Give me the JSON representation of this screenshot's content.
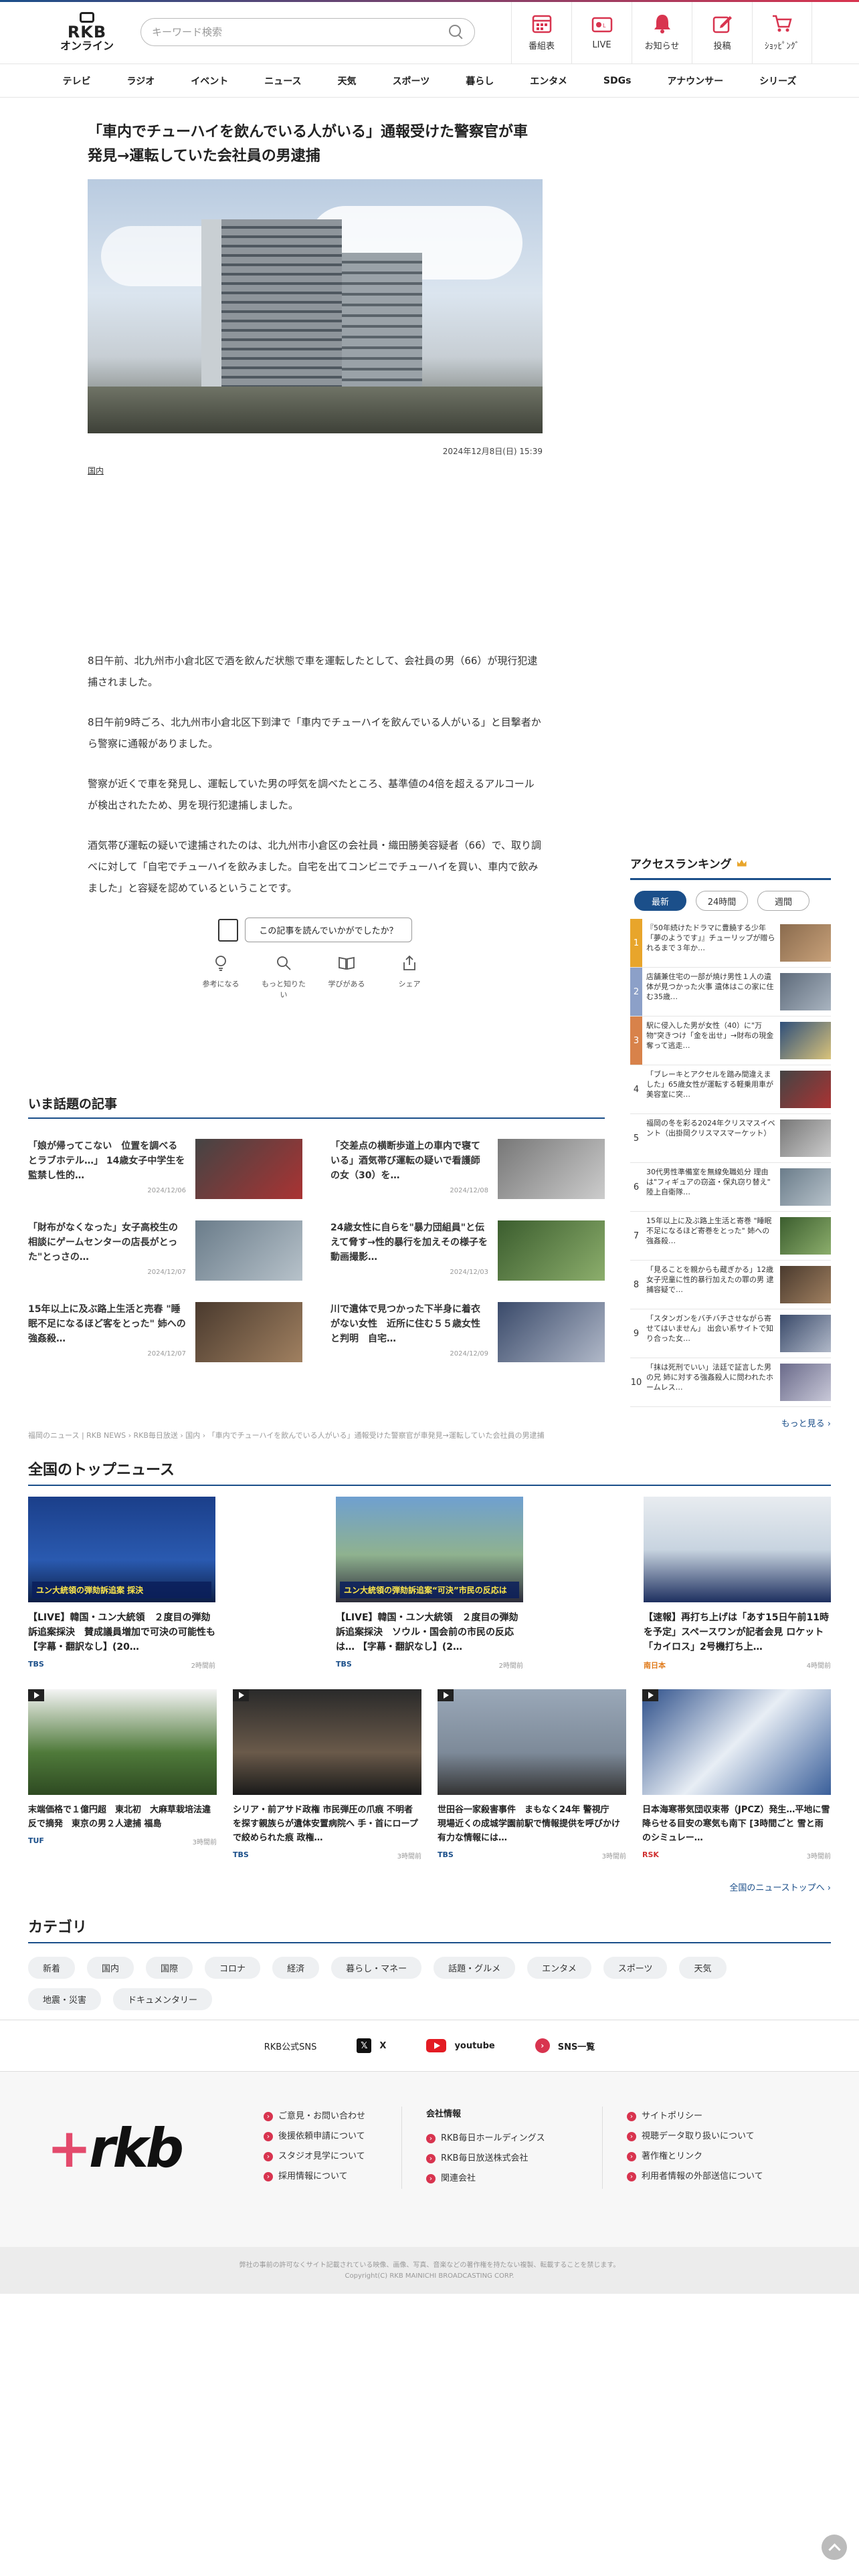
{
  "header": {
    "logo_line1": "RKB",
    "logo_line2": "オンライン",
    "search_placeholder": "キーワード検索",
    "nav": [
      {
        "label": "番組表",
        "color": "#d8344f"
      },
      {
        "label": "LIVE",
        "color": "#d8344f"
      },
      {
        "label": "お知らせ",
        "color": "#d8344f"
      },
      {
        "label": "投稿",
        "color": "#d8344f"
      },
      {
        "label": "ｼｮｯﾋﾟﾝｸﾞ",
        "color": "#d8344f"
      }
    ]
  },
  "global_nav": [
    "テレビ",
    "ラジオ",
    "イベント",
    "ニュース",
    "天気",
    "スポーツ",
    "暮らし",
    "エンタメ",
    "SDGs",
    "アナウンサー",
    "シリーズ"
  ],
  "article": {
    "title": "「車内でチューハイを飲んでいる人がいる」通報受けた警察官が車発見→運転していた会社員の男逮捕",
    "date": "2024年12月8日(日) 15:39",
    "category": "国内",
    "paragraphs": [
      "8日午前、北九州市小倉北区で酒を飲んだ状態で車を運転したとして、会社員の男（66）が現行犯逮捕されました。",
      "8日午前9時ごろ、北九州市小倉北区下到津で「車内でチューハイを飲んでいる人がいる」と目撃者から警察に通報がありました。",
      "警察が近くで車を発見し、運転していた男の呼気を調べたところ、基準値の4倍を超えるアルコールが検出されたため、男を現行犯逮捕しました。",
      "酒気帯び運転の疑いで逮捕されたのは、北九州市小倉区の会社員・織田勝美容疑者（66）で、取り調べに対して「自宅でチューハイを飲みました。自宅を出てコンビニでチューハイを買い、車内で飲みました」と容疑を認めているということです。"
    ],
    "feedback": {
      "question": "この記事を読んでいかがでしたか？",
      "buttons": [
        "参考になる",
        "もっと知りたい",
        "学びがある",
        "シェア"
      ]
    }
  },
  "ranking": {
    "title": "アクセスランキング",
    "tabs": [
      "最新",
      "24時間",
      "週間"
    ],
    "items": [
      {
        "num": "1",
        "color": "#e8a52b",
        "text": "『50年続けたドラマに豊饒する少年「夢のようです」』チューリップが贈られるまで３年か…"
      },
      {
        "num": "2",
        "color": "#8ca0c8",
        "text": "店舗兼住宅の一部が焼け男性１人の遺体が見つかった火事 遺体はこの家に住む35歳…"
      },
      {
        "num": "3",
        "color": "#d8824a",
        "text": "駅に侵入した男が女性（40）に\"万物\"突きつけ「金を出せ」→財布の現金奪って逃走…"
      },
      {
        "num": "4",
        "color": "#fff",
        "text": "「ブレーキとアクセルを踏み間違えました」65歳女性が運転する軽乗用車が美容室に突…"
      },
      {
        "num": "5",
        "color": "#fff",
        "text": "福岡の冬を彩る2024年クリスマスイベント（出掛岡クリスマスマーケット）"
      },
      {
        "num": "6",
        "color": "#fff",
        "text": "30代男性準備室を無線免職処分 理由は\"フィギュアの窃盗・保丸窃り替え\" 陸上自衛隊…"
      },
      {
        "num": "7",
        "color": "#fff",
        "text": "15年以上に及ぶ路上生活と寄巻 \"睡眠不足になるほど寄巻をとった\" 姉への強姦殺…"
      },
      {
        "num": "8",
        "color": "#fff",
        "text": "「見ることを親からも蔵ぎかる」12歳女子児童に性的暴行加えたの罪の男 逮捕容疑で…"
      },
      {
        "num": "9",
        "color": "#fff",
        "text": "「スタンガンをバチバチさせながら寄せてはいません」 出会い系サイトで知り合った女…"
      },
      {
        "num": "10",
        "color": "#fff",
        "text": "「抹は死刑でいい」法廷で証言した男の兄 姉に対する強姦殺人に問われたホームレス…"
      }
    ],
    "more": "もっと見る ›"
  },
  "trending": {
    "title": "いま話題の記事",
    "items": [
      {
        "text": "「娘が帰ってこない　位置を調べるとラブホテル…」 14歳女子中学生を監禁し性的…",
        "date": "2024/12/06"
      },
      {
        "text": "「交差点の横断歩道上の車内で寝ている」酒気帯び運転の疑いで看護師の女（30）を…",
        "date": "2024/12/08"
      },
      {
        "text": "「財布がなくなった」女子高校生の相談にゲームセンターの店長がとった\"とっさの…",
        "date": "2024/12/07"
      },
      {
        "text": "24歳女性に自らを\"暴力団組員\"と伝えて脅す→性的暴行を加えその様子を動画撮影…",
        "date": "2024/12/03"
      },
      {
        "text": "15年以上に及ぶ路上生活と売春 \"睡眠不足になるほど客をとった\" 姉への強姦殺…",
        "date": "2024/12/07"
      },
      {
        "text": "川で遺体で見つかった下半身に着衣がない女性　近所に住む５５歳女性と判明　自宅…",
        "date": "2024/12/09"
      }
    ]
  },
  "breadcrumb": "福岡のニュース | RKB NEWS › RKB毎日放送 › 国内 › 「車内でチューハイを飲んでいる人がいる」通報受けた警察官が車発見→運転していた会社員の男逮捕",
  "top_news": {
    "title": "全国のトップニュース",
    "big": [
      {
        "text": "【LIVE】韓国・ユン大統領　２度目の弾劾訴追案採決　賛成議員増加で可決の可能性も 【字幕・翻訳なし】(20…",
        "source": "TBS",
        "ago": "2時間前",
        "caption": "ユン大統領の弾劾訴追案 採決"
      },
      {
        "text": "【LIVE】韓国・ユン大統領　２度目の弾劾訴追案採決　ソウル・国会前の市民の反応は… 【字幕・翻訳なし】(2…",
        "source": "TBS",
        "ago": "2時間前",
        "caption": "ユン大統領の弾劾訴追案“可決”市民の反応は"
      },
      {
        "text": "【速報】再打ち上げは「あす15日午前11時を予定」スペースワンが記者会見 ロケット「カイロス」2号機打ち上…",
        "source": "南日本",
        "ago": "4時間前",
        "caption": ""
      }
    ],
    "small": [
      {
        "text": "末端価格で１億円超　東北初　大麻草栽培法違反で摘発　東京の男２人逮捕 福島",
        "source": "TUF",
        "ago": "3時間前"
      },
      {
        "text": "シリア・前アサド政権 市民弾圧の爪痕 不明者を探す親族らが遺体安置病院へ 手・首にロープで絞められた痕 政権…",
        "source": "TBS",
        "ago": "3時間前"
      },
      {
        "text": "世田谷一家殺害事件　まもなく24年 警視庁　現場近くの成城学園前駅で情報提供を呼びかけ　有力な情報には…",
        "source": "TBS",
        "ago": "3時間前"
      },
      {
        "text": "日本海寒帯気団収束帯（JPCZ）発生…平地に雪降らせる目安の寒気も南下 [3時間ごと 雪と雨のシミュレー…",
        "source": "RSK",
        "ago": "3時間前"
      }
    ],
    "all_link": "全国のニューストップへ ›"
  },
  "categories": {
    "title": "カテゴリ",
    "chips": [
      "新着",
      "国内",
      "国際",
      "コロナ",
      "経済",
      "暮らし・マネー",
      "話題・グルメ",
      "エンタメ",
      "スポーツ",
      "天気",
      "地震・災害",
      "ドキュメンタリー"
    ]
  },
  "sns": {
    "label": "RKB公式SNS",
    "x": "X",
    "youtube": "youtube",
    "list": "SNS一覧"
  },
  "footer": {
    "logo": "rkb",
    "col1": [
      "ご意見・お問い合わせ",
      "後援依頼申請について",
      "スタジオ見学について",
      "採用情報について"
    ],
    "col2_title": "会社情報",
    "col2": [
      "RKB毎日ホールディングス",
      "RKB毎日放送株式会社",
      "関連会社"
    ],
    "col3": [
      "サイトポリシー",
      "視聴データ取り扱いについて",
      "著作権とリンク",
      "利用者情報の外部送信について"
    ],
    "legal1": "弊社の事前の許可なくサイト記載されている映像、画像、写真、音楽などの著作権を持たない複製、転載することを禁じます。",
    "legal2": "Copyright(C) RKB MAINICHI BROADCASTING CORP."
  }
}
